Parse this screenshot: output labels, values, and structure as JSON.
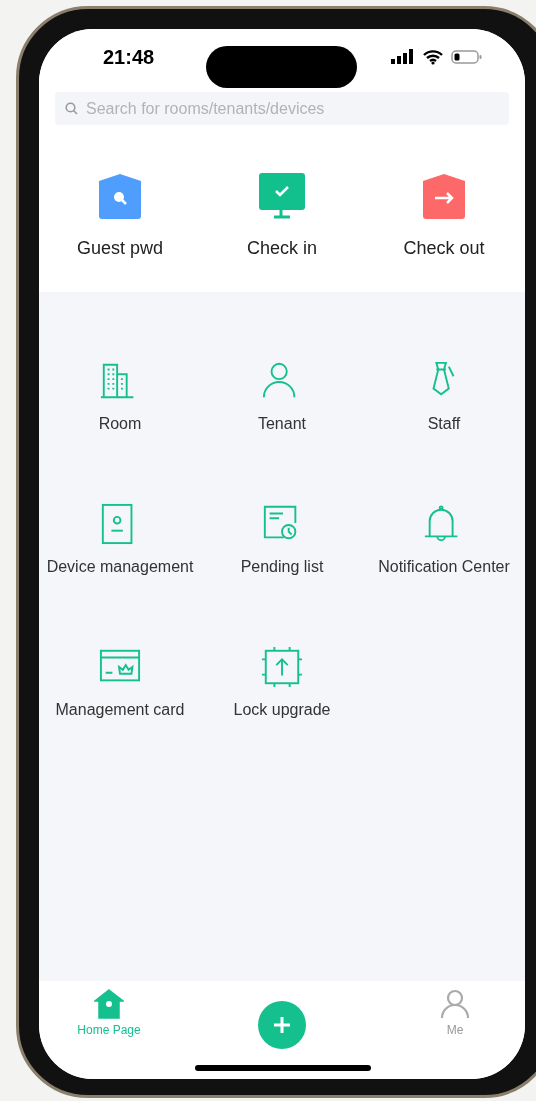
{
  "status_bar": {
    "time": "21:48"
  },
  "search": {
    "placeholder": "Search for rooms/tenants/devices"
  },
  "quick_actions": [
    {
      "kind": "guest",
      "label": "Guest pwd",
      "color": "#4f9dfc"
    },
    {
      "kind": "checkin",
      "label": "Check in",
      "color": "#12c08e"
    },
    {
      "kind": "checkout",
      "label": "Check out",
      "color": "#fd6868"
    }
  ],
  "menu": [
    {
      "kind": "room",
      "label": "Room"
    },
    {
      "kind": "tenant",
      "label": "Tenant"
    },
    {
      "kind": "staff",
      "label": "Staff"
    },
    {
      "kind": "device",
      "label": "Device management"
    },
    {
      "kind": "pending",
      "label": "Pending list"
    },
    {
      "kind": "bell",
      "label": "Notification Center"
    },
    {
      "kind": "card",
      "label": "Management card"
    },
    {
      "kind": "upgrade",
      "label": "Lock upgrade"
    }
  ],
  "tab_bar": [
    {
      "kind": "home",
      "label": "Home Page",
      "selected": true
    },
    {
      "kind": "add"
    },
    {
      "kind": "me",
      "label": "Me",
      "selected": false
    }
  ]
}
